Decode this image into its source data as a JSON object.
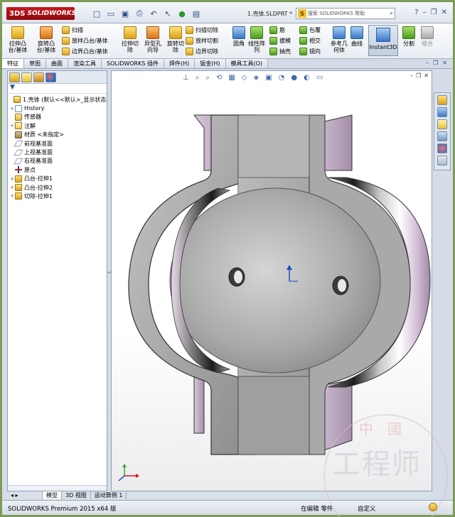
{
  "app": {
    "logo_text": "SOLIDWORKS",
    "logo_mark": "3DS",
    "doc_title": "1.壳体.SLDPRT *"
  },
  "search": {
    "badge": "S",
    "placeholder": "搜索 SOLIDWORKS 帮助"
  },
  "quick_access": [
    "new-icon",
    "open-icon",
    "save-icon",
    "print-icon",
    "undo-icon",
    "select-icon",
    "rebuild-icon",
    "options-icon"
  ],
  "ribbon": {
    "extrude_boss": "拉伸凸\n台/基体",
    "revolve_boss": "旋转凸\n台/基体",
    "sweep": "扫描",
    "loft_boss": "放样凸台/基体",
    "boundary_boss": "边界凸台/基体",
    "extrude_cut": "拉伸切\n除",
    "hole_wizard": "异型孔\n向导",
    "revolve_cut": "旋转切\n除",
    "sweep_cut": "扫描切除",
    "loft_cut": "放样切割",
    "boundary_cut": "边界切除",
    "fillet": "圆角",
    "linear_pattern": "线性阵\n列",
    "rib": "筋",
    "draft": "拔模",
    "shell": "抽壳",
    "wrap": "包覆",
    "intersect": "相交",
    "mirror": "镜向",
    "ref_geometry": "参考几\n何体",
    "curves": "曲线",
    "instant3d": "Instant3D",
    "split": "分割",
    "combine": "组合"
  },
  "tabs": [
    "特征",
    "草图",
    "曲面",
    "渲染工具",
    "SOLIDWORKS 插件",
    "焊件(H)",
    "钣金(H)",
    "模具工具(O)"
  ],
  "tree": {
    "filter_symbol": "▼",
    "root": "1.壳体 (默认<<默认>_显示状态",
    "items": [
      {
        "label": "History",
        "icon": "history-icon",
        "expander": "+"
      },
      {
        "label": "传感器",
        "icon": "sensor-icon",
        "expander": ""
      },
      {
        "label": "注解",
        "icon": "annotation-icon",
        "expander": "+"
      },
      {
        "label": "材质 <未指定>",
        "icon": "material-icon",
        "expander": ""
      },
      {
        "label": "前视基准面",
        "icon": "plane-icon",
        "expander": ""
      },
      {
        "label": "上视基准面",
        "icon": "plane-icon",
        "expander": ""
      },
      {
        "label": "右视基准面",
        "icon": "plane-icon",
        "expander": ""
      },
      {
        "label": "原点",
        "icon": "origin-icon",
        "expander": ""
      },
      {
        "label": "凸台-拉伸1",
        "icon": "boss-extrude-icon",
        "expander": "+"
      },
      {
        "label": "凸台-拉伸2",
        "icon": "boss-extrude-icon",
        "expander": "+"
      },
      {
        "label": "切除-拉伸1",
        "icon": "cut-extrude-icon",
        "expander": "+"
      }
    ]
  },
  "bottom_tabs": [
    "模型",
    "3D 视图",
    "运动算例 1"
  ],
  "status": {
    "product": "SOLIDWORKS Premium 2015 x64 版",
    "mode": "在编辑 零件",
    "units": "自定义"
  },
  "watermark": {
    "top": "中國",
    "main": "工程师"
  },
  "colors": {
    "frame": "#7d9c5a",
    "part_face": "#a5a5a5",
    "part_side": "#c9b8cf",
    "accent": "#2f74c7"
  }
}
